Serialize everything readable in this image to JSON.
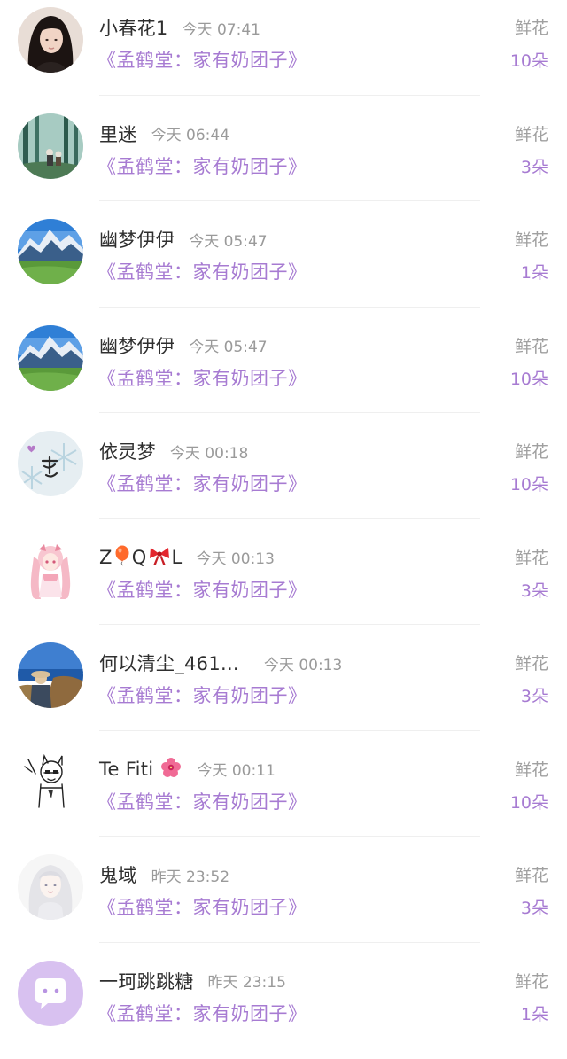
{
  "rows": [
    {
      "name": "小春花1",
      "time": "今天 07:41",
      "book": "《孟鹤堂：家有奶团子》",
      "gift": "鲜花",
      "count": "10朵",
      "avatar": "portrait-avatar"
    },
    {
      "name": "里迷",
      "time": "今天 06:44",
      "book": "《孟鹤堂：家有奶团子》",
      "gift": "鲜花",
      "count": "3朵",
      "avatar": "forest-avatar"
    },
    {
      "name": "幽梦伊伊",
      "time": "今天 05:47",
      "book": "《孟鹤堂：家有奶团子》",
      "gift": "鲜花",
      "count": "1朵",
      "avatar": "mountain-avatar"
    },
    {
      "name": "幽梦伊伊",
      "time": "今天 05:47",
      "book": "《孟鹤堂：家有奶团子》",
      "gift": "鲜花",
      "count": "10朵",
      "avatar": "mountain-avatar"
    },
    {
      "name": "依灵梦",
      "time": "今天 00:18",
      "book": "《孟鹤堂：家有奶团子》",
      "gift": "鲜花",
      "count": "10朵",
      "avatar": "snowflake-avatar"
    },
    {
      "name_parts": [
        "Z",
        "Q",
        "L"
      ],
      "time": "今天 00:13",
      "book": "《孟鹤堂：家有奶团子》",
      "gift": "鲜花",
      "count": "3朵",
      "avatar": "anime-girl-avatar"
    },
    {
      "name": "何以清尘_461...",
      "time": "今天 00:13",
      "book": "《孟鹤堂：家有奶团子》",
      "gift": "鲜花",
      "count": "3朵",
      "avatar": "seaside-avatar"
    },
    {
      "name": "Te Fiti",
      "time": "今天 00:11",
      "book": "《孟鹤堂：家有奶团子》",
      "gift": "鲜花",
      "count": "10朵",
      "avatar": "sketch-avatar"
    },
    {
      "name": "鬼域",
      "time": "昨天 23:52",
      "book": "《孟鹤堂：家有奶团子》",
      "gift": "鲜花",
      "count": "3朵",
      "avatar": "white-hair-avatar"
    },
    {
      "name": "一珂跳跳糖",
      "time": "昨天 23:15",
      "book": "《孟鹤堂：家有奶团子》",
      "gift": "鲜花",
      "count": "1朵",
      "avatar": "chat-bubble-avatar"
    }
  ],
  "colors": {
    "accent": "#a77bd2",
    "name": "#2f2f2f",
    "muted": "#9a9a9a",
    "divider": "#efefef"
  }
}
